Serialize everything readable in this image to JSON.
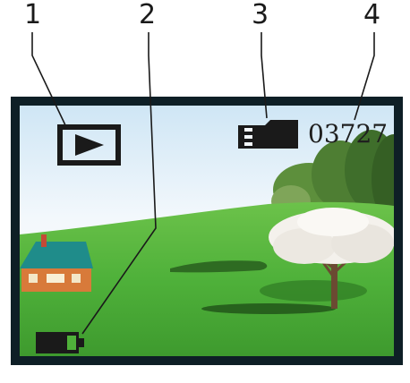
{
  "callouts": {
    "one": "1",
    "two": "2",
    "three": "3",
    "four": "4"
  },
  "screen": {
    "file_counter": "03727",
    "icons": {
      "mode": "play-icon",
      "battery": "battery-icon",
      "memory": "sd-card-icon"
    },
    "colors": {
      "bezel": "#0e1f26",
      "icon": "#1a1a1a",
      "sky": "#e9f3fb",
      "grass": "#4fb13a"
    }
  }
}
